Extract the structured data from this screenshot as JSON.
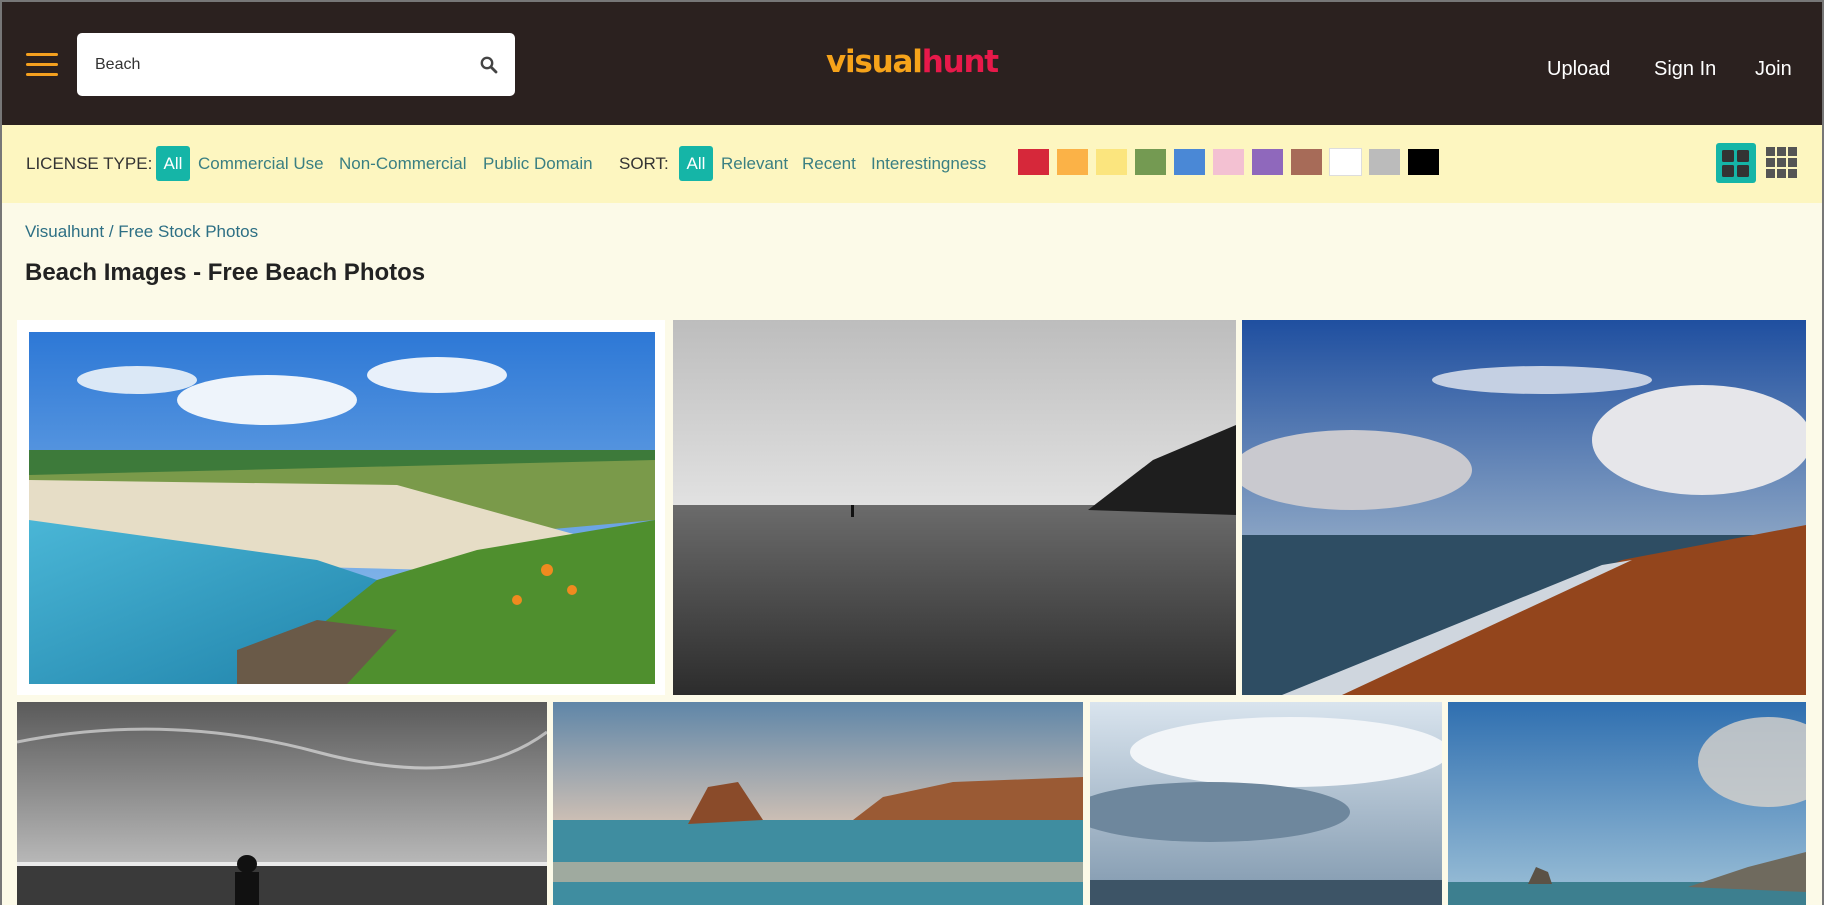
{
  "header": {
    "search": {
      "value": "Beach"
    },
    "logo": {
      "part1": "visual",
      "part2": "hunt"
    },
    "nav": {
      "upload": "Upload",
      "sign_in": "Sign In",
      "join": "Join"
    }
  },
  "filters": {
    "license_label": "LICENSE TYPE:",
    "license_options": [
      "All",
      "Commercial Use",
      "Non-Commercial",
      "Public Domain"
    ],
    "sort_label": "SORT:",
    "sort_options": [
      "All",
      "Relevant",
      "Recent",
      "Interestingness"
    ],
    "colors": [
      "#d6283a",
      "#fbb247",
      "#fbe57e",
      "#749a52",
      "#4a88d6",
      "#f3c1d2",
      "#8f68bc",
      "#a76b58",
      "#ffffff",
      "#bbbbbb",
      "#000000"
    ]
  },
  "breadcrumb": {
    "home": "Visualhunt",
    "separator": "/",
    "section": "Free Stock Photos"
  },
  "page_title": "Beach Images - Free Beach Photos",
  "photos": [
    "coastal beach with wildflowers",
    "black and white beach with lone walker",
    "beach shoreline with dramatic clouds",
    "black and white swimmers silhouette",
    "sea rocks at sunset",
    "stormy sky over sea",
    "blue sky coastline with rocks"
  ]
}
